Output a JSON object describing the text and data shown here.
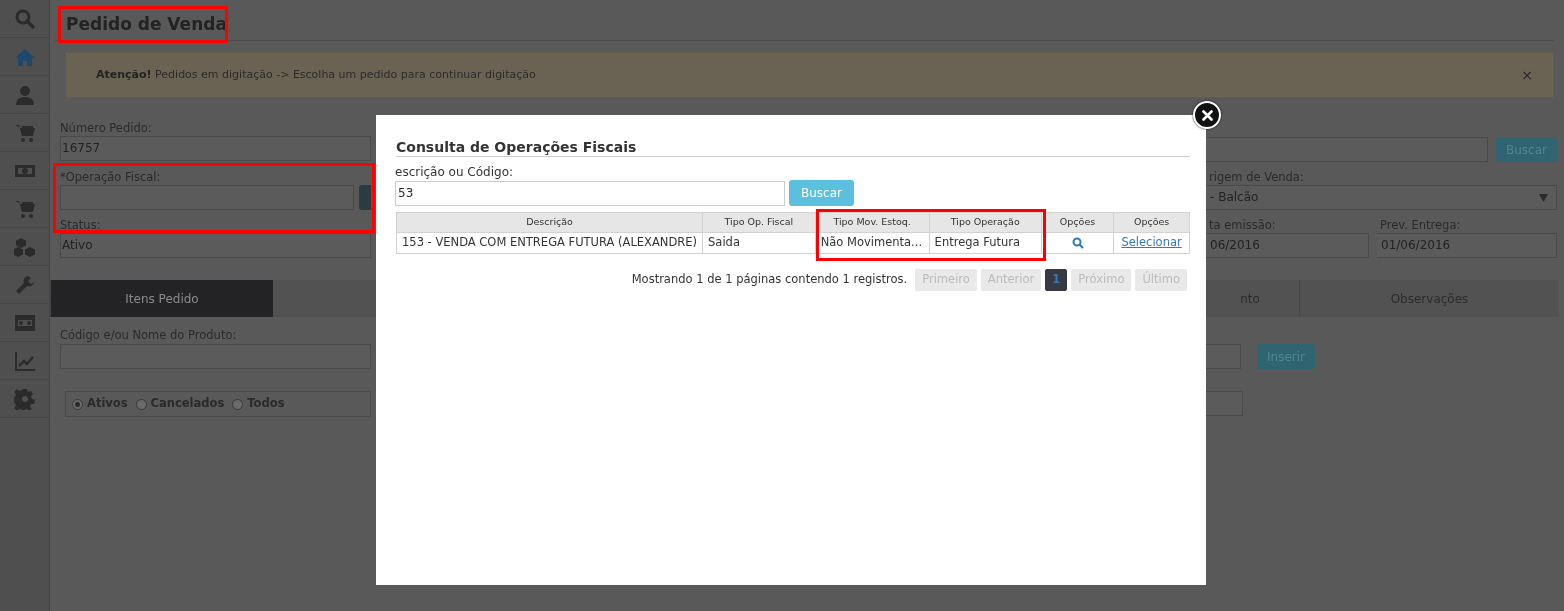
{
  "sidebar": {
    "items": [
      {
        "selected": false
      },
      {
        "selected": true
      },
      {
        "selected": false
      },
      {
        "selected": false
      },
      {
        "selected": false
      },
      {
        "selected": false
      },
      {
        "selected": false
      },
      {
        "selected": false
      },
      {
        "selected": false
      },
      {
        "selected": false
      },
      {
        "selected": false
      }
    ]
  },
  "page": {
    "title": "Pedido de Venda",
    "alert": {
      "text": "**Atenção!** Pedidos em digitação -> Escolha um pedido para continuar digitação",
      "close": "×"
    },
    "numero": {
      "label": "Número Pedido:",
      "value": "16757"
    },
    "operacao": {
      "label": "*Operação Fiscal:"
    },
    "status": {
      "label": "Status:",
      "value": "Ativo"
    },
    "search_button": "Buscar",
    "origem": {
      "label": "rigem de Venda:",
      "value": "- Balcão"
    },
    "emissao": {
      "label": "ta emissão:",
      "value": "06/2016"
    },
    "entrega": {
      "label": "Prev. Entrega:",
      "value": "01/06/2016"
    },
    "tabs": [
      {
        "label": "Itens Pedido",
        "selected": true
      },
      {
        "label": "nto",
        "selected": false
      },
      {
        "label": "Observações",
        "selected": false
      }
    ],
    "produto": {
      "label": "Código e/ou Nome do Produto:"
    },
    "insert_button": "Inserir",
    "status_filter": [
      {
        "label": "Ativos",
        "selected": true
      },
      {
        "label": "Cancelados",
        "selected": false
      },
      {
        "label": "Todos",
        "selected": false
      }
    ]
  },
  "modal": {
    "title": "Consulta de Operações Fiscais",
    "search": {
      "label": "escrição ou Código:",
      "value": "53"
    },
    "search_button": "Buscar",
    "table": {
      "columns": [
        "Descrição",
        "Tipo Op. Fiscal",
        "Tipo Mov. Estoq.",
        "Tipo Operação",
        "Opções",
        "Opções"
      ],
      "rows": [
        {
          "cells": [
            "153 - VENDA COM ENTREGA FUTURA (ALEXANDRE)",
            "Saida",
            "Não Movimenta...",
            "Entrega Futura"
          ],
          "action": "Selecionar"
        }
      ]
    },
    "summary": "Mostrando 1 de 1 páginas contendo 1 registros.",
    "pages": [
      {
        "label": "Primeiro",
        "selected": false,
        "disabled": true
      },
      {
        "label": "Anterior",
        "selected": false,
        "disabled": true
      },
      {
        "label": "1",
        "selected": true,
        "disabled": false
      },
      {
        "label": "Próximo",
        "selected": false,
        "disabled": true
      },
      {
        "label": "Último",
        "selected": false,
        "disabled": true
      }
    ]
  }
}
